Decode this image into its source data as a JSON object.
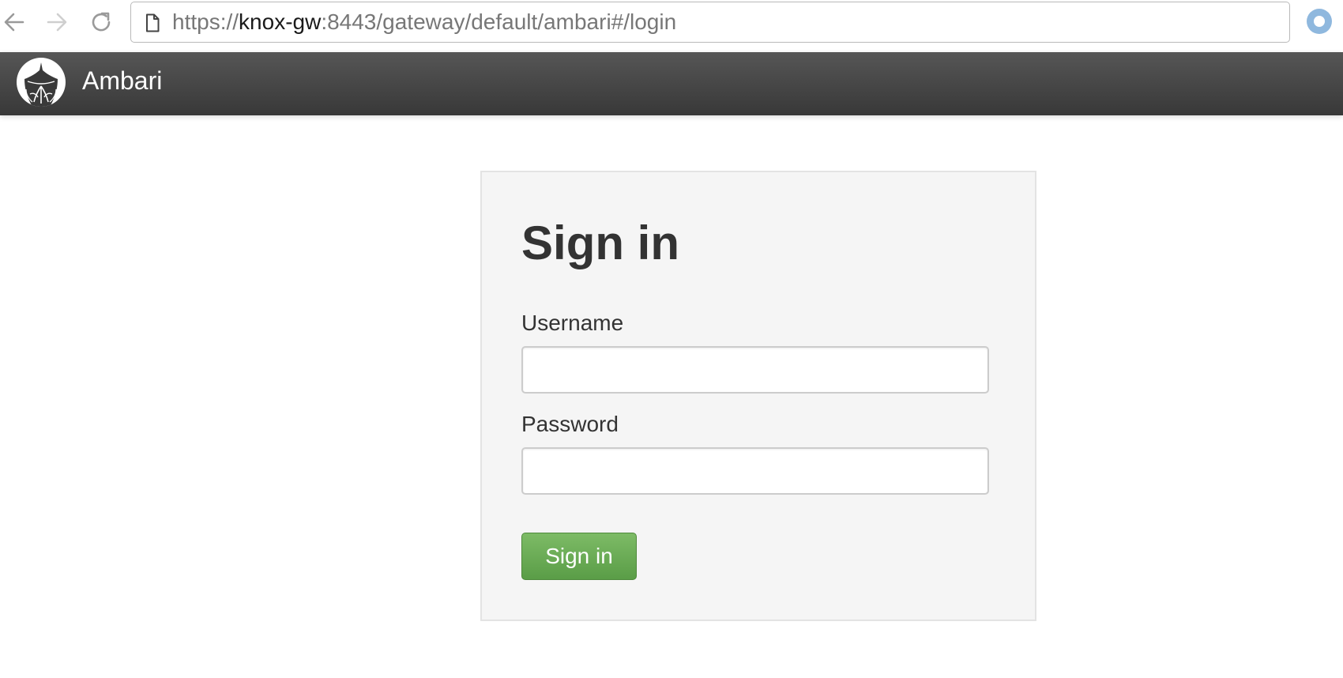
{
  "browser": {
    "url_prefix": "https://",
    "url_host": "knox-gw",
    "url_rest": ":8443/gateway/default/ambari#/login",
    "icons": {
      "back": "arrow-left-icon",
      "forward": "arrow-right-icon",
      "reload": "reload-icon",
      "page": "page-icon",
      "extension": "extension-icon"
    }
  },
  "navbar": {
    "brand": "Ambari",
    "logo_icon": "ambari-logo-icon"
  },
  "login": {
    "title": "Sign in",
    "username_label": "Username",
    "username_value": "",
    "password_label": "Password",
    "password_value": "",
    "submit_label": "Sign in"
  },
  "colors": {
    "navbar_top": "#565656",
    "navbar_bottom": "#383838",
    "panel_bg": "#f5f5f5",
    "button_green": "#6aab54",
    "text_dark": "#333333"
  }
}
